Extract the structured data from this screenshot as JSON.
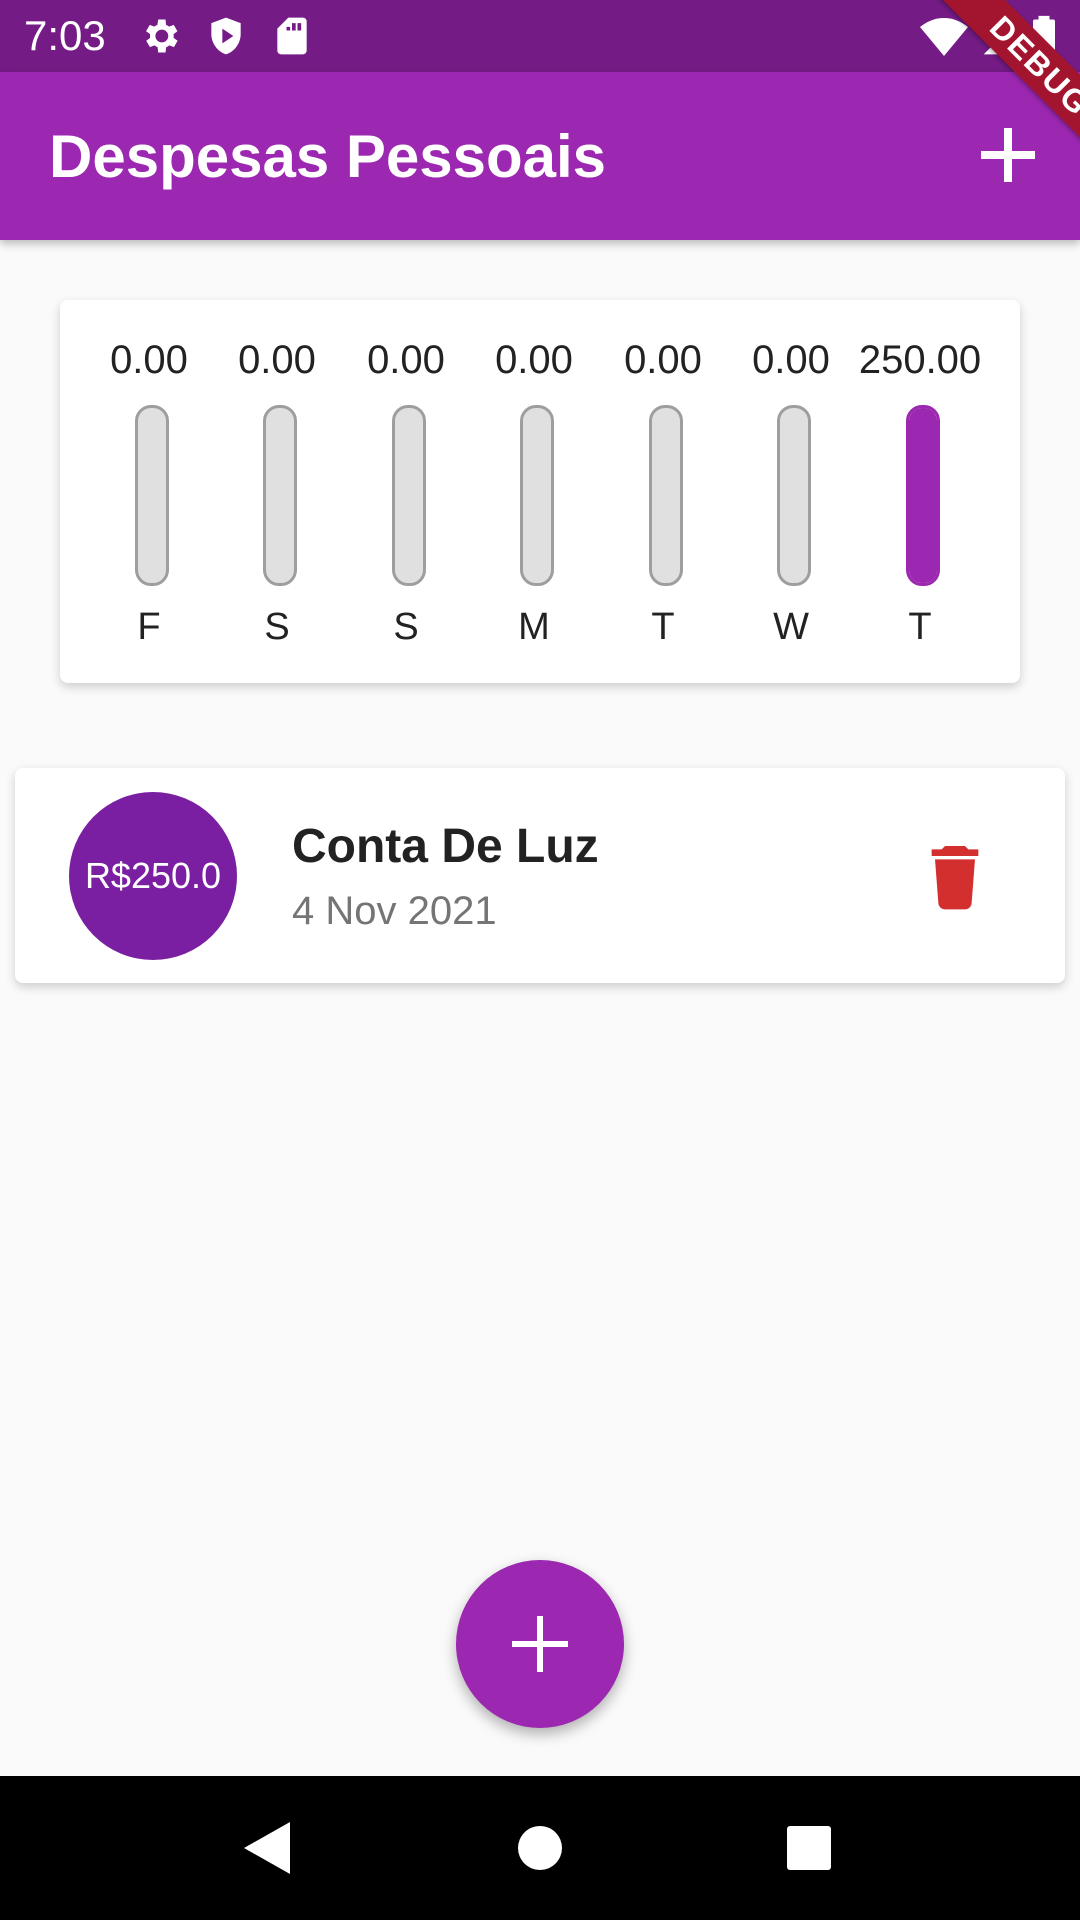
{
  "status_bar": {
    "time": "7:03",
    "left_icons": [
      "gear-icon",
      "play-protect-icon",
      "sd-card-icon"
    ],
    "right_icons": [
      "wifi-icon",
      "signal-icon",
      "battery-icon"
    ]
  },
  "debug_banner": "DEBUG",
  "app_bar": {
    "title": "Despesas Pessoais",
    "action_icon": "plus-icon"
  },
  "chart": {
    "accent_color": "#9c27b0",
    "bars": [
      {
        "day": "F",
        "amount": "0.00",
        "fill": 0
      },
      {
        "day": "S",
        "amount": "0.00",
        "fill": 0
      },
      {
        "day": "S",
        "amount": "0.00",
        "fill": 0
      },
      {
        "day": "M",
        "amount": "0.00",
        "fill": 0
      },
      {
        "day": "T",
        "amount": "0.00",
        "fill": 0
      },
      {
        "day": "W",
        "amount": "0.00",
        "fill": 0
      },
      {
        "day": "T",
        "amount": "250.00",
        "fill": 1
      }
    ]
  },
  "transactions": [
    {
      "amount": "R$250.0",
      "title": "Conta De Luz",
      "date": "4 Nov 2021",
      "delete_icon": "trash-icon"
    }
  ],
  "fab_icon": "plus-icon",
  "nav_bar": [
    "back-icon",
    "home-icon",
    "recents-icon"
  ],
  "colors": {
    "primary": "#9c27b0",
    "status_bar": "#741b86",
    "avatar": "#7b1fa2",
    "delete": "#d32f2f"
  }
}
